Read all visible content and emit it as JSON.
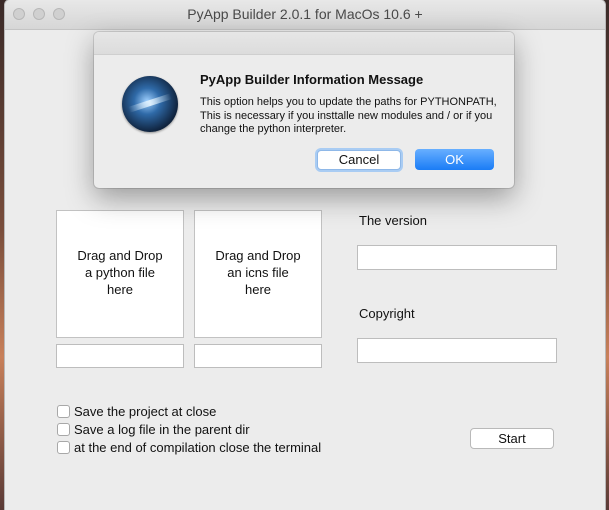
{
  "window": {
    "title": "PyApp Builder 2.0.1 for MacOs 10.6 +"
  },
  "dialog": {
    "title": "PyApp Builder Information Message",
    "message": "This option helps you to update the paths for PYTHONPATH, This is necessary if you insttalle new modules and / or if you change the python interpreter.",
    "cancel_label": "Cancel",
    "ok_label": "OK"
  },
  "main": {
    "dropzone_python": "Drag and Drop\na python file\nhere",
    "dropzone_icns": "Drag and Drop\nan icns file\nhere",
    "python_path_value": "",
    "icns_path_value": "",
    "version_label": "The version",
    "version_value": "",
    "copyright_label": "Copyright",
    "copyright_value": "",
    "options": [
      {
        "label": "Save the project at close",
        "checked": false
      },
      {
        "label": "Save a log file in the parent dir",
        "checked": false
      },
      {
        "label": "at the end of compilation close the terminal",
        "checked": false
      }
    ],
    "start_label": "Start"
  }
}
